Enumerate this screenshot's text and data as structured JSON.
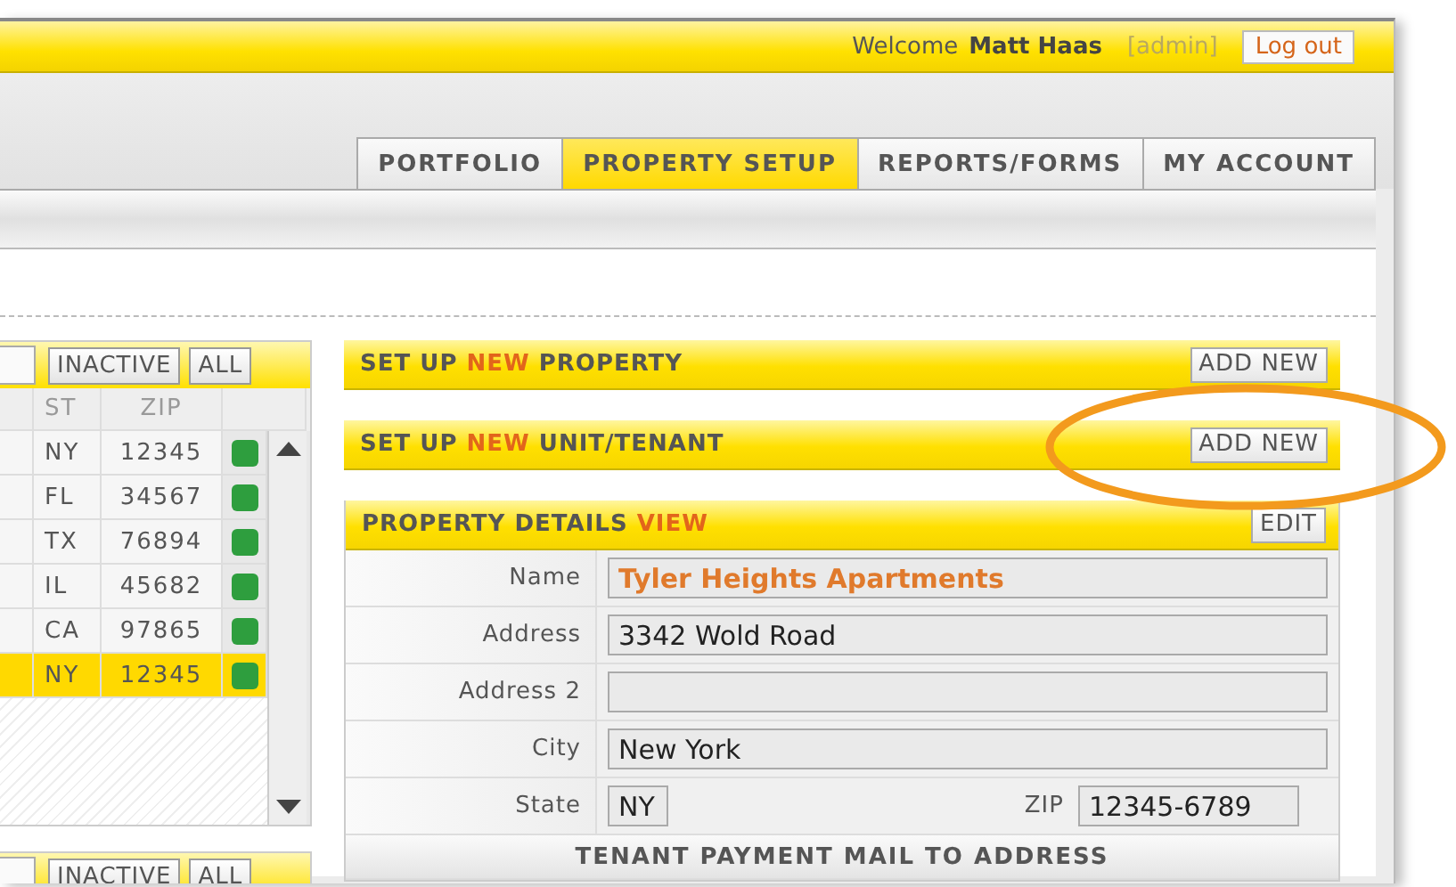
{
  "header": {
    "welcome": "Welcome",
    "user": "Matt Haas",
    "role": "[admin]",
    "logout": "Log out"
  },
  "tabs": [
    {
      "label": "PORTFOLIO",
      "selected": false
    },
    {
      "label": "PROPERTY SETUP",
      "selected": true
    },
    {
      "label": "REPORTS/FORMS",
      "selected": false
    },
    {
      "label": "MY ACCOUNT",
      "selected": false
    }
  ],
  "property_list": {
    "filters": [
      "INACTIVE",
      "ALL"
    ],
    "columns": [
      "ST",
      "ZIP"
    ],
    "rows": [
      {
        "st": "NY",
        "zip": "12345",
        "color": "#2e9e3e",
        "selected": false
      },
      {
        "st": "FL",
        "zip": "34567",
        "color": "#2e9e3e",
        "selected": false
      },
      {
        "st": "TX",
        "zip": "76894",
        "color": "#2e9e3e",
        "selected": false
      },
      {
        "st": "IL",
        "zip": "45682",
        "color": "#2e9e3e",
        "selected": false
      },
      {
        "st": "CA",
        "zip": "97865",
        "color": "#2e9e3e",
        "selected": false
      },
      {
        "st": "NY",
        "zip": "12345",
        "color": "#2e9e3e",
        "selected": true
      }
    ]
  },
  "tenant_list": {
    "filters": [
      "INACTIVE",
      "ALL"
    ]
  },
  "sections": [
    {
      "title": "SET UP",
      "accent": "NEW",
      "title_end": "PROPERTY",
      "action": "ADD NEW"
    },
    {
      "title": "SET UP",
      "accent": "NEW",
      "title_end": "UNIT/TENANT",
      "action": "ADD NEW"
    }
  ],
  "details": {
    "title": "PROPERTY DETAILS",
    "accent": "VIEW",
    "action": "EDIT",
    "fields": [
      {
        "kind": "name",
        "label": "Name",
        "value": "Tyler Heights Apartments"
      },
      {
        "kind": "text",
        "label": "Address",
        "value": "3342 Wold Road"
      },
      {
        "kind": "text",
        "label": "Address 2"
      },
      {
        "kind": "text",
        "label": "City",
        "value": "New York"
      },
      {
        "kind": "pair",
        "label": "State",
        "value": "NY",
        "label2": "ZIP",
        "value2": "12345-6789"
      },
      {
        "kind": "heading",
        "label": "TENANT PAYMENT MAIL TO ADDRESS"
      }
    ]
  }
}
